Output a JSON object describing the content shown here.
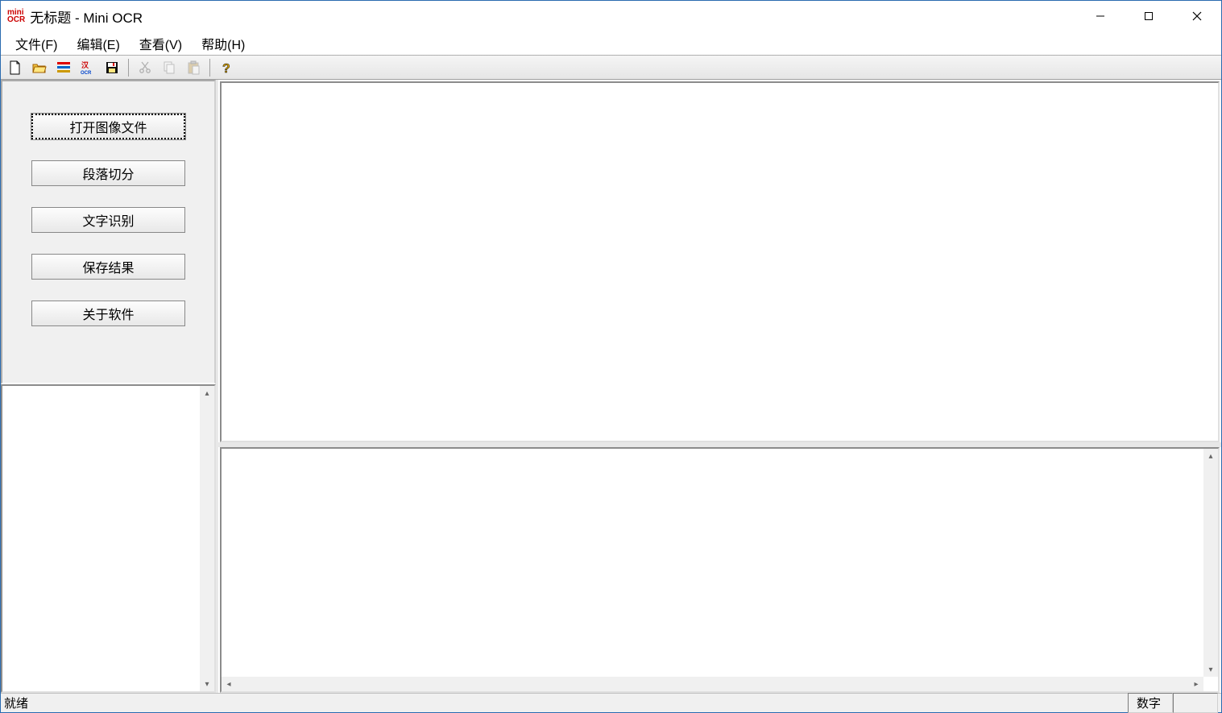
{
  "app": {
    "icon_top": "mini",
    "icon_bottom": "OCR",
    "title": "无标题 - Mini OCR"
  },
  "menubar": {
    "file": "文件(F)",
    "edit": "编辑(E)",
    "view": "查看(V)",
    "help": "帮助(H)"
  },
  "toolbar": {
    "icons": {
      "new": "new-file-icon",
      "open": "open-folder-icon",
      "segment": "segment-icon",
      "ocr": "ocr-icon",
      "save": "save-icon",
      "cut": "cut-icon",
      "copy": "copy-icon",
      "paste": "paste-icon",
      "help": "help-icon"
    }
  },
  "sidebar": {
    "open_image": "打开图像文件",
    "segment": "段落切分",
    "recognize": "文字识别",
    "save_result": "保存结果",
    "about": "关于软件"
  },
  "status": {
    "ready": "就绪",
    "numlock": "数字"
  }
}
